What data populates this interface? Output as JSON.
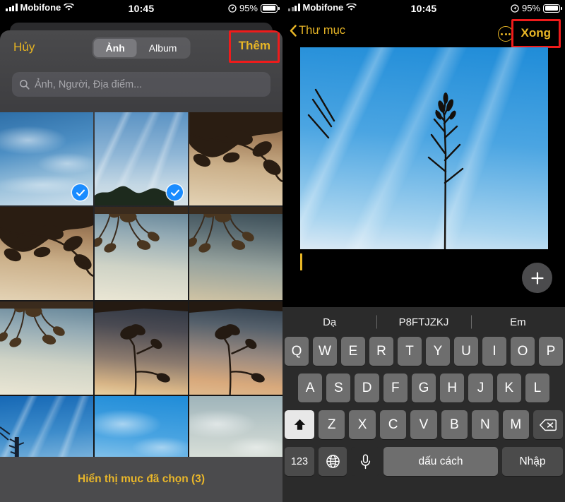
{
  "status_bar": {
    "carrier": "Mobifone",
    "time": "10:45",
    "battery_percent": "95%",
    "icons": {
      "signal": "signal-bars-icon",
      "wifi": "wifi-icon",
      "location": "location-arrow-icon",
      "battery": "battery-icon"
    }
  },
  "left_panel": {
    "name": "photo-picker-sheet",
    "cancel_label": "Hủy",
    "add_label": "Thêm",
    "segmented": {
      "options": [
        "Ảnh",
        "Album"
      ],
      "selected": "Ảnh"
    },
    "search": {
      "placeholder": "Ảnh, Người, Địa điểm...",
      "value": "",
      "icon": "search-icon"
    },
    "bottom_bar_label": "Hiển thị mục đã chọn (3)",
    "selected_count": 3,
    "grid": {
      "columns": 3,
      "cells": [
        {
          "id": "photo-1",
          "art": "sky-deep",
          "selected": true,
          "overlay": "clouds"
        },
        {
          "id": "photo-2",
          "art": "sky-pale",
          "selected": true,
          "overlay": "wisps",
          "silhouette": "treeline"
        },
        {
          "id": "photo-3",
          "art": "dusk-warm",
          "selected": false,
          "silhouette": "branch"
        },
        {
          "id": "photo-4",
          "art": "dusk-warm",
          "selected": false,
          "silhouette": "branch"
        },
        {
          "id": "photo-5",
          "art": "dusk-pale",
          "selected": false,
          "silhouette": "flowers"
        },
        {
          "id": "photo-6",
          "art": "dusk-teal",
          "selected": false,
          "silhouette": "flowers"
        },
        {
          "id": "photo-7",
          "art": "dusk-pale",
          "selected": false,
          "silhouette": "flowers"
        },
        {
          "id": "photo-8",
          "art": "dusk-dark",
          "selected": false,
          "silhouette": "singleflower"
        },
        {
          "id": "photo-9",
          "art": "dusk-rose",
          "selected": false,
          "silhouette": "singleflower"
        },
        {
          "id": "photo-10",
          "art": "sky-blue2",
          "selected": false,
          "overlay": "wisps",
          "silhouette": "pole"
        },
        {
          "id": "photo-11",
          "art": "sky-bright",
          "selected": false,
          "overlay": "clouds"
        },
        {
          "id": "photo-12",
          "art": "sky-hazy",
          "selected": false,
          "overlay": "clouds"
        }
      ]
    }
  },
  "right_panel": {
    "name": "note-editor",
    "back_label": "Thư mục",
    "more_icon": "ellipsis-circle-icon",
    "done_label": "Xong",
    "attached_image": "sky-with-bare-tree",
    "add_attachment_icon": "plus-icon",
    "body_text": ""
  },
  "keyboard": {
    "predictions": [
      "Dạ",
      "P8FTJZKJ",
      "Em"
    ],
    "rows": [
      [
        "Q",
        "W",
        "E",
        "R",
        "T",
        "Y",
        "U",
        "I",
        "O",
        "P"
      ],
      [
        "A",
        "S",
        "D",
        "F",
        "G",
        "H",
        "J",
        "K",
        "L"
      ],
      [
        "Z",
        "X",
        "C",
        "V",
        "B",
        "N",
        "M"
      ]
    ],
    "shift_icon": "shift-up-arrow-icon",
    "delete_icon": "backspace-icon",
    "numeric_label": "123",
    "globe_icon": "globe-icon",
    "mic_icon": "microphone-icon",
    "space_label": "dấu cách",
    "enter_label": "Nhập",
    "shift_active": true
  },
  "colors": {
    "accent_yellow": "#e8b626",
    "highlight_red": "#ef1b1b",
    "selection_blue": "#1a8cff",
    "keyboard_bg": "#2b2b2b",
    "key_bg": "#6e6e6e",
    "key_fn_bg": "#4b4b4b"
  }
}
